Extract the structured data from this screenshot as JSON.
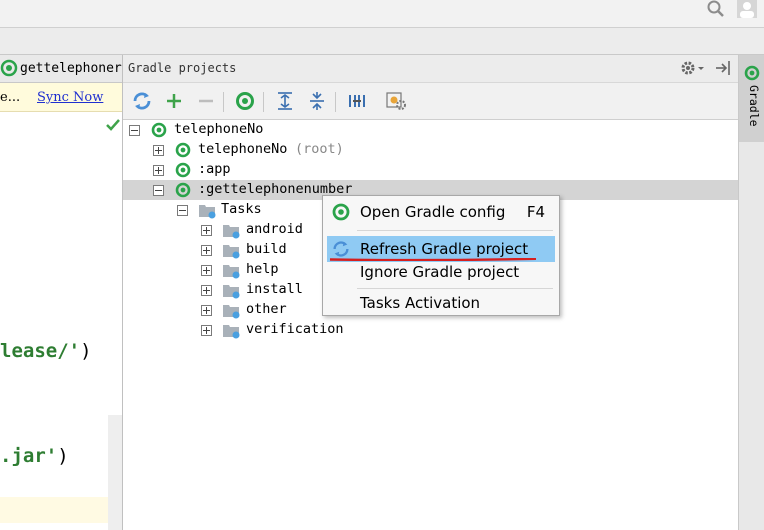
{
  "editor": {
    "tab_label": "gettelephoner",
    "sync_prefix": "e...",
    "sync_link": "Sync Now",
    "code_line_1": "lease/'",
    "code_line_1_paren": ")",
    "code_line_2": ".jar'",
    "code_line_2_paren": ")"
  },
  "gradle_panel": {
    "title": "Gradle projects",
    "toolbar": [
      {
        "name": "refresh-all-icon"
      },
      {
        "name": "add-icon"
      },
      {
        "name": "remove-icon"
      },
      {
        "name": "gradle-task-icon"
      },
      {
        "name": "expand-all-icon"
      },
      {
        "name": "collapse-all-icon"
      },
      {
        "name": "toggle-offline-icon"
      },
      {
        "name": "gradle-settings-icon"
      }
    ],
    "tree": {
      "root": "telephoneNo",
      "child_root": "telephoneNo",
      "child_root_suffix": "(root)",
      "app": ":app",
      "module": ":gettelephonenumber",
      "tasks": "Tasks",
      "task_groups": [
        "android",
        "build",
        "help",
        "install",
        "other",
        "verification"
      ]
    }
  },
  "side_strip": {
    "label": "Gradle"
  },
  "context_menu": {
    "items": [
      {
        "label": "Open Gradle config",
        "shortcut": "F4"
      },
      {
        "label": "Refresh Gradle project",
        "shortcut": ""
      },
      {
        "label": "Ignore Gradle project",
        "shortcut": ""
      },
      {
        "label": "Tasks Activation",
        "shortcut": ""
      }
    ]
  },
  "colors": {
    "gradle_green": "#2aa34a",
    "selection_blue": "#8fcaf3",
    "underline_red": "#d61f1f",
    "link_blue": "#1f2fd0",
    "code_green": "#2e7d32"
  }
}
